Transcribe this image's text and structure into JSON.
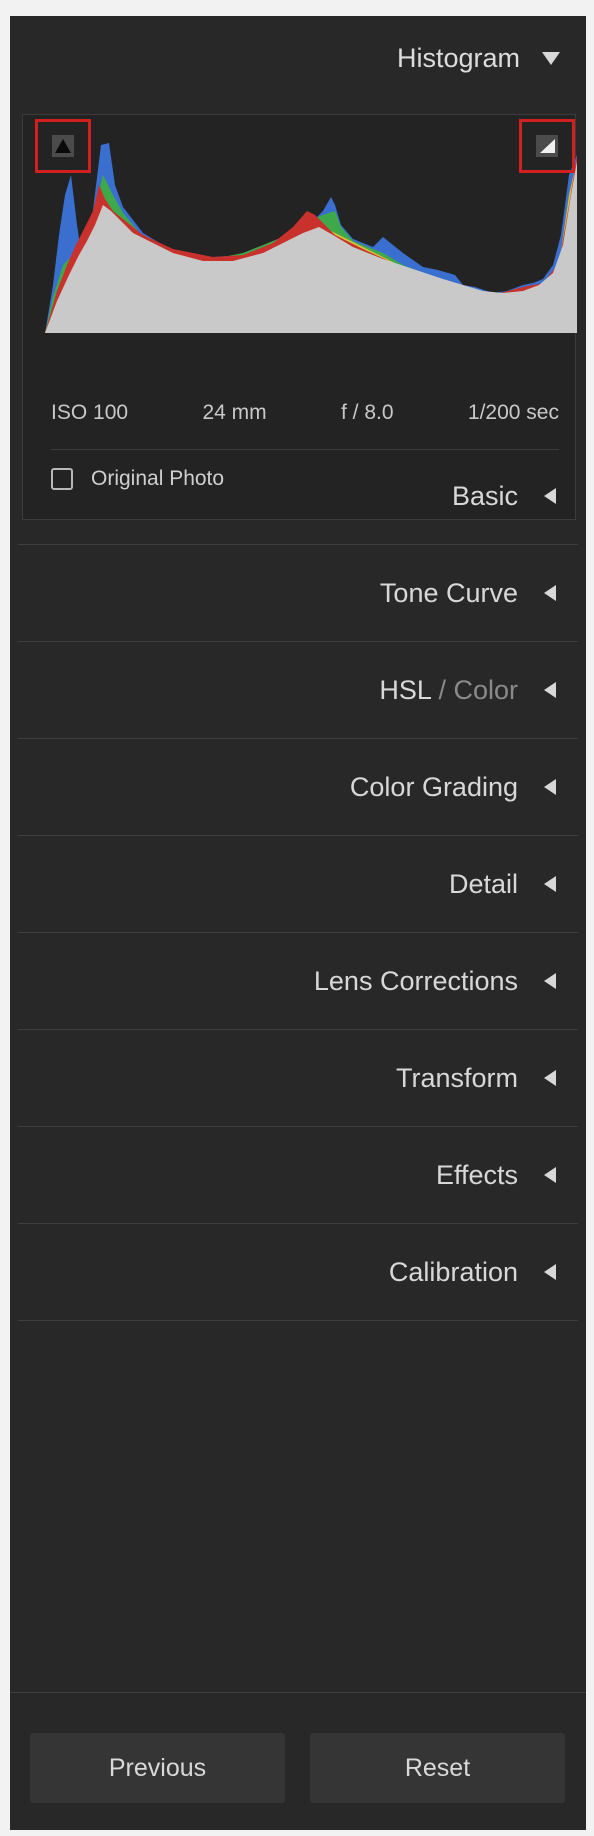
{
  "histogram": {
    "title": "Histogram",
    "shadow_clip_icon": "shadow-clipping-warning-icon",
    "highlight_clip_icon": "highlight-clipping-warning-icon",
    "exif": {
      "iso": "ISO 100",
      "focal_length": "24 mm",
      "aperture": "f / 8.0",
      "shutter": "1/200 sec"
    },
    "original_photo_label": "Original Photo",
    "original_photo_checked": false
  },
  "sections": {
    "basic": "Basic",
    "tone_curve": "Tone Curve",
    "hsl": "HSL",
    "hsl_sep": "/",
    "color": "Color",
    "color_grading": "Color Grading",
    "detail": "Detail",
    "lens_corrections": "Lens Corrections",
    "transform": "Transform",
    "effects": "Effects",
    "calibration": "Calibration"
  },
  "footer": {
    "previous_label": "Previous",
    "reset_label": "Reset"
  },
  "colors": {
    "panel_bg": "#282828",
    "highlight_box": "#d21f1f",
    "text": "#d8d8d8"
  }
}
